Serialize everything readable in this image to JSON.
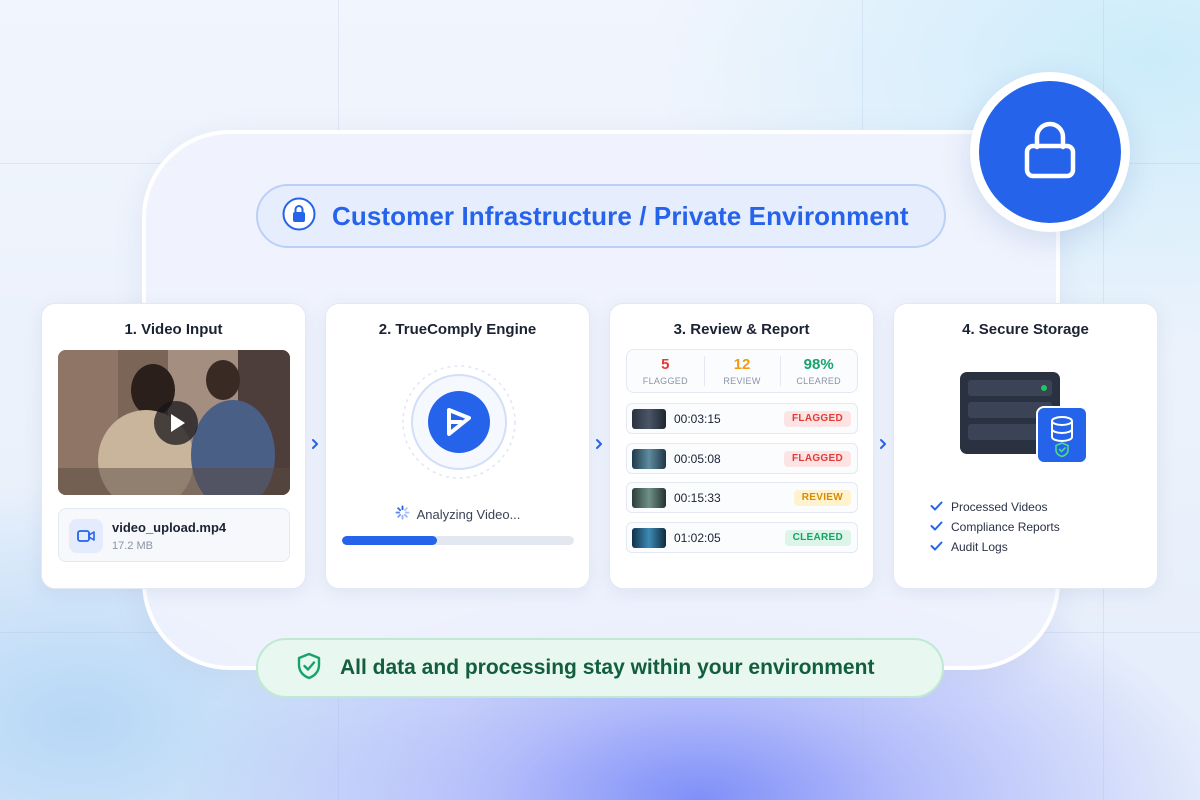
{
  "environment": {
    "title": "Customer Infrastructure / Private Environment"
  },
  "steps": [
    {
      "title": "1. Video Input",
      "file_name": "video_upload.mp4",
      "file_size": "17.2 MB"
    },
    {
      "title": "2. TrueComply Engine",
      "status": "Analyzing Video...",
      "progress": 0.41
    },
    {
      "title": "3. Review & Report",
      "stats": [
        {
          "value": "5",
          "label": "FLAGGED",
          "color": "#e53935"
        },
        {
          "value": "12",
          "label": "REVIEW",
          "color": "#f29a10"
        },
        {
          "value": "98%",
          "label": "CLEARED",
          "color": "#16a36a"
        }
      ],
      "rows": [
        {
          "time": "00:03:15",
          "status": "FLAGGED"
        },
        {
          "time": "00:05:08",
          "status": "FLAGGED"
        },
        {
          "time": "00:15:33",
          "status": "REVIEW"
        },
        {
          "time": "01:02:05",
          "status": "CLEARED"
        }
      ]
    },
    {
      "title": "4. Secure Storage",
      "items": [
        "Processed Videos",
        "Compliance Reports",
        "Audit Logs"
      ]
    }
  ],
  "footer": {
    "message": "All data and processing stay within your environment"
  },
  "colors": {
    "accent": "#2563eb",
    "flagged_bg": "#fde4e4",
    "flagged_fg": "#e53935",
    "review_bg": "#fff3cf",
    "review_fg": "#d98a00",
    "cleared_bg": "#dcf5e8",
    "cleared_fg": "#16a36a"
  },
  "icons": [
    "lock-icon",
    "play-icon",
    "video-camera-icon",
    "engine-logo-icon",
    "spinner-icon",
    "server-icon",
    "database-shield-icon",
    "checkmark-icon",
    "shield-check-icon",
    "chevron-right-icon"
  ]
}
